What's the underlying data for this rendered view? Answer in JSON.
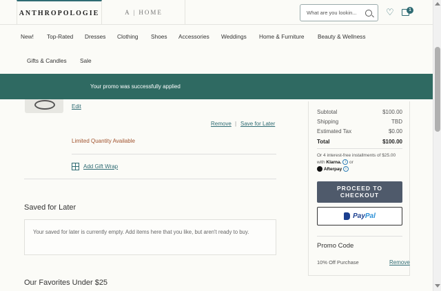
{
  "header": {
    "tabs": [
      {
        "label": "ANTHROPOLOGIE",
        "active": true
      },
      {
        "label": "A | HOME",
        "active": false
      }
    ],
    "search": {
      "placeholder": "What are you lookin..."
    },
    "icons": [
      "search-icon",
      "heart-icon",
      "bag-icon"
    ],
    "bag_count": "1"
  },
  "nav": {
    "items": [
      "New!",
      "Top-Rated",
      "Dresses",
      "Clothing",
      "Shoes",
      "Accessories",
      "Weddings",
      "Home & Furniture",
      "Beauty & Wellness",
      "Gifts & Candles",
      "Sale"
    ]
  },
  "promo_banner": {
    "text": "Your promo was successfully applied",
    "color": "#2f6a62"
  },
  "cart_item": {
    "edit_label": "Edit",
    "remove_label": "Remove",
    "separator": "|",
    "save_for_later_label": "Save for Later",
    "stock_note": "Limited Quantity Available",
    "gift_wrap_label": "Add Gift Wrap"
  },
  "saved_for_later": {
    "title": "Saved for Later",
    "empty_message": "Your saved for later is currently empty. Add items here that you like, but aren't ready to buy."
  },
  "favorites": {
    "title": "Our Favorites Under $25"
  },
  "summary": {
    "rows": [
      {
        "label": "Subtotal",
        "value": "$100.00"
      },
      {
        "label": "Shipping",
        "value": "TBD"
      },
      {
        "label": "Estimated Tax",
        "value": "$0.00"
      }
    ],
    "total": {
      "label": "Total",
      "value": "$100.00"
    },
    "installments": {
      "prefix": "Or 4 interest-free installments of $25.00 with",
      "klarna": "Klarna.",
      "or": "or",
      "afterpay": "Afterpay"
    },
    "checkout_label": "PROCEED TO CHECKOUT",
    "paypal": {
      "pay": "Pay",
      "pal": "Pal"
    },
    "promo_title": "Promo Code",
    "promo_applied": "10% Off Purchase",
    "promo_remove": "Remove"
  },
  "theme": {
    "accent": "#2e6b73",
    "checkout_bg": "#4f5a6b"
  }
}
